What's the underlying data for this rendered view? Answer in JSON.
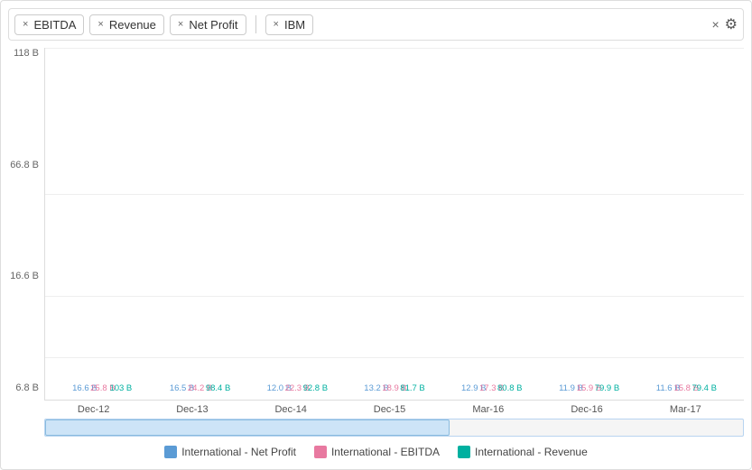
{
  "filterBar": {
    "tags": [
      {
        "label": "EBITDA",
        "id": "ebitda"
      },
      {
        "label": "Revenue",
        "id": "revenue"
      },
      {
        "label": "Net Profit",
        "id": "net-profit"
      },
      {
        "label": "IBM",
        "id": "ibm"
      }
    ]
  },
  "chart": {
    "yLabels": [
      "118 B",
      "66.8 B",
      "16.6 B",
      "6.8 B"
    ],
    "groups": [
      {
        "xLabel": "Dec-12",
        "bars": [
          {
            "value": 16.6,
            "label": "16.6 B",
            "color": "#5b9bd5",
            "series": "net-profit"
          },
          {
            "value": 25.8,
            "label": "25.8 B",
            "color": "#e879a0",
            "series": "ebitda"
          },
          {
            "value": 103,
            "label": "103 B",
            "color": "#00b0a0",
            "series": "revenue"
          }
        ]
      },
      {
        "xLabel": "Dec-13",
        "bars": [
          {
            "value": 16.5,
            "label": "16.5 B",
            "color": "#5b9bd5",
            "series": "net-profit"
          },
          {
            "value": 24.2,
            "label": "24.2 B",
            "color": "#e879a0",
            "series": "ebitda"
          },
          {
            "value": 98.4,
            "label": "98.4 B",
            "color": "#00b0a0",
            "series": "revenue"
          }
        ]
      },
      {
        "xLabel": "Dec-14",
        "bars": [
          {
            "value": 12.0,
            "label": "12.0 B",
            "color": "#5b9bd5",
            "series": "net-profit"
          },
          {
            "value": 22.3,
            "label": "22.3 B",
            "color": "#e879a0",
            "series": "ebitda"
          },
          {
            "value": 92.8,
            "label": "92.8 B",
            "color": "#00b0a0",
            "series": "revenue"
          }
        ]
      },
      {
        "xLabel": "Dec-15",
        "bars": [
          {
            "value": 13.2,
            "label": "13.2 B",
            "color": "#5b9bd5",
            "series": "net-profit"
          },
          {
            "value": 18.9,
            "label": "18.9 B",
            "color": "#e879a0",
            "series": "ebitda"
          },
          {
            "value": 81.7,
            "label": "81.7 B",
            "color": "#00b0a0",
            "series": "revenue"
          }
        ]
      },
      {
        "xLabel": "Mar-16",
        "bars": [
          {
            "value": 12.9,
            "label": "12.9 B",
            "color": "#5b9bd5",
            "series": "net-profit"
          },
          {
            "value": 17.3,
            "label": "17.3 B",
            "color": "#e879a0",
            "series": "ebitda"
          },
          {
            "value": 80.8,
            "label": "80.8 B",
            "color": "#00b0a0",
            "series": "revenue"
          }
        ]
      },
      {
        "xLabel": "Dec-16",
        "bars": [
          {
            "value": 11.9,
            "label": "11.9 B",
            "color": "#5b9bd5",
            "series": "net-profit"
          },
          {
            "value": 15.9,
            "label": "15.9 B",
            "color": "#e879a0",
            "series": "ebitda"
          },
          {
            "value": 79.9,
            "label": "79.9 B",
            "color": "#00b0a0",
            "series": "revenue"
          }
        ]
      },
      {
        "xLabel": "Mar-17",
        "bars": [
          {
            "value": 11.6,
            "label": "11.6 B",
            "color": "#5b9bd5",
            "series": "net-profit"
          },
          {
            "value": 15.8,
            "label": "15.8 B",
            "color": "#e879a0",
            "series": "ebitda"
          },
          {
            "value": 79.4,
            "label": "79.4 B",
            "color": "#00b0a0",
            "series": "revenue"
          }
        ]
      }
    ],
    "maxValue": 118,
    "chartHeight": 300
  },
  "legend": {
    "items": [
      {
        "label": "International - Net Profit",
        "color": "#5b9bd5"
      },
      {
        "label": "International - EBITDA",
        "color": "#e879a0"
      },
      {
        "label": "International - Revenue",
        "color": "#00b0a0"
      }
    ]
  },
  "scrollbar": {
    "thumbLeft": "0%",
    "thumbWidth": "58%"
  }
}
